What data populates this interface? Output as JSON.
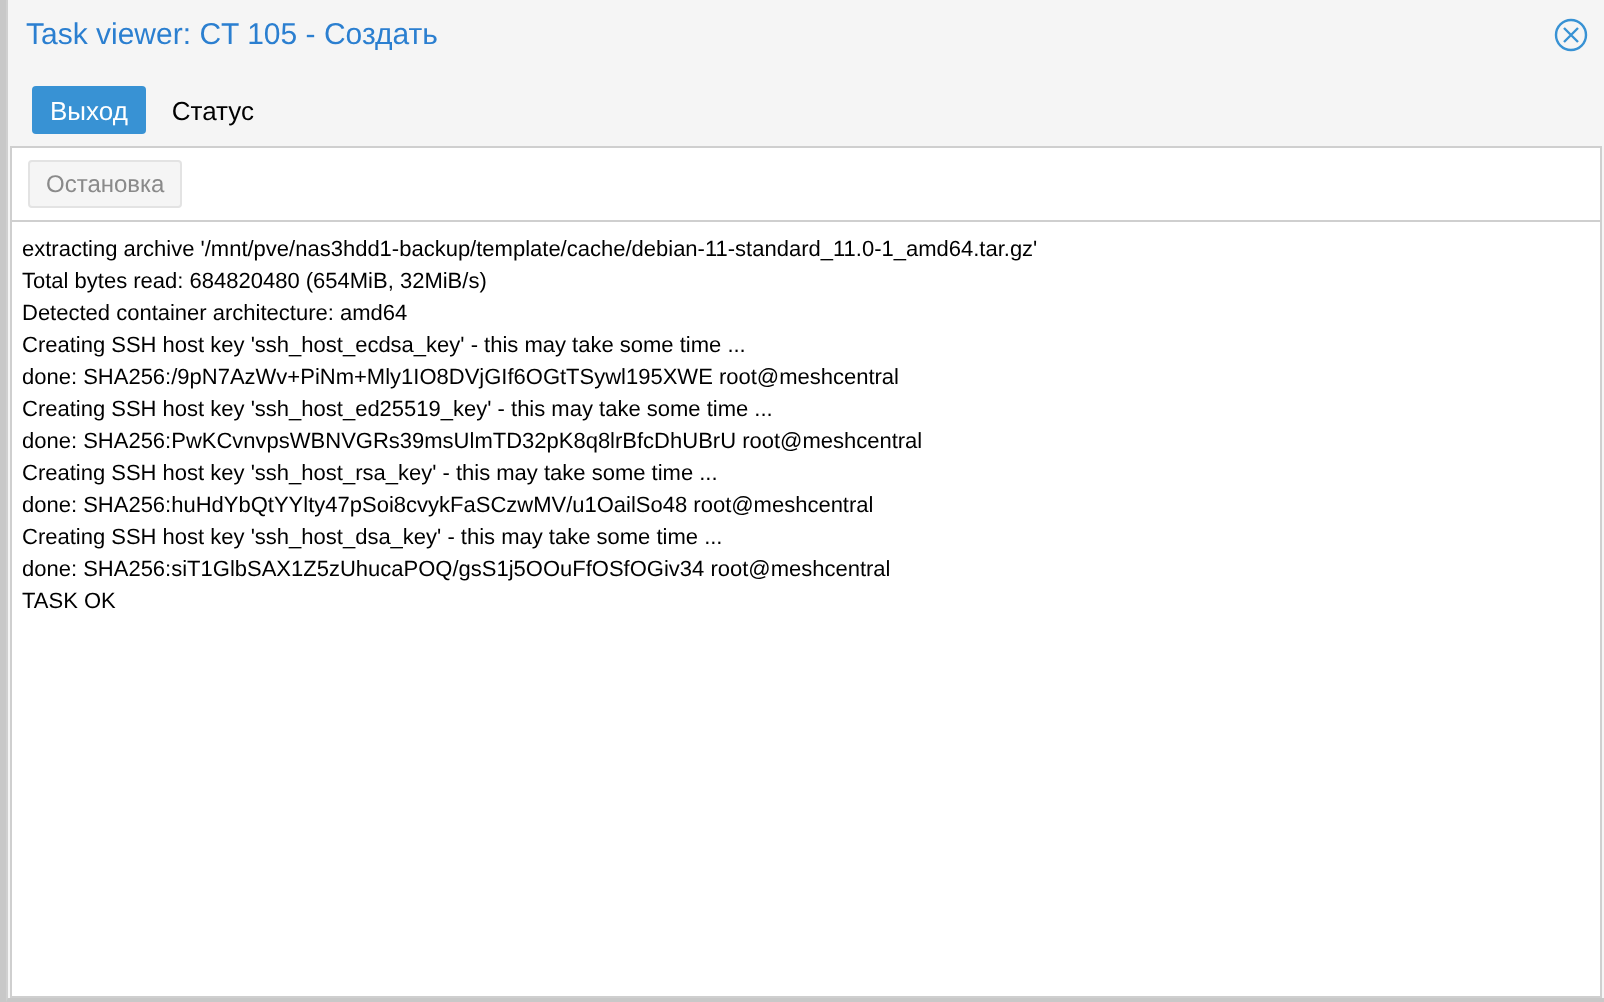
{
  "window": {
    "title": "Task viewer: CT 105 - Создать"
  },
  "tabs": [
    {
      "label": "Выход",
      "selected": true
    },
    {
      "label": "Статус",
      "selected": false
    }
  ],
  "toolbar": {
    "stop_button": {
      "label": "Остановка",
      "disabled": true
    }
  },
  "log": [
    "extracting archive '/mnt/pve/nas3hdd1-backup/template/cache/debian-11-standard_11.0-1_amd64.tar.gz'",
    "Total bytes read: 684820480 (654MiB, 32MiB/s)",
    "Detected container architecture: amd64",
    "Creating SSH host key 'ssh_host_ecdsa_key' - this may take some time ...",
    "done: SHA256:/9pN7AzWv+PiNm+Mly1IO8DVjGIf6OGtTSywl195XWE root@meshcentral",
    "Creating SSH host key 'ssh_host_ed25519_key' - this may take some time ...",
    "done: SHA256:PwKCvnvpsWBNVGRs39msUlmTD32pK8q8lrBfcDhUBrU root@meshcentral",
    "Creating SSH host key 'ssh_host_rsa_key' - this may take some time ...",
    "done: SHA256:huHdYbQtYYlty47pSoi8cvykFaSCzwMV/u1OailSo48 root@meshcentral",
    "Creating SSH host key 'ssh_host_dsa_key' - this may take some time ...",
    "done: SHA256:siT1GlbSAX1Z5zUhucaPOQ/gsS1j5OOuFfOSfOGiv34 root@meshcentral",
    "TASK OK"
  ]
}
